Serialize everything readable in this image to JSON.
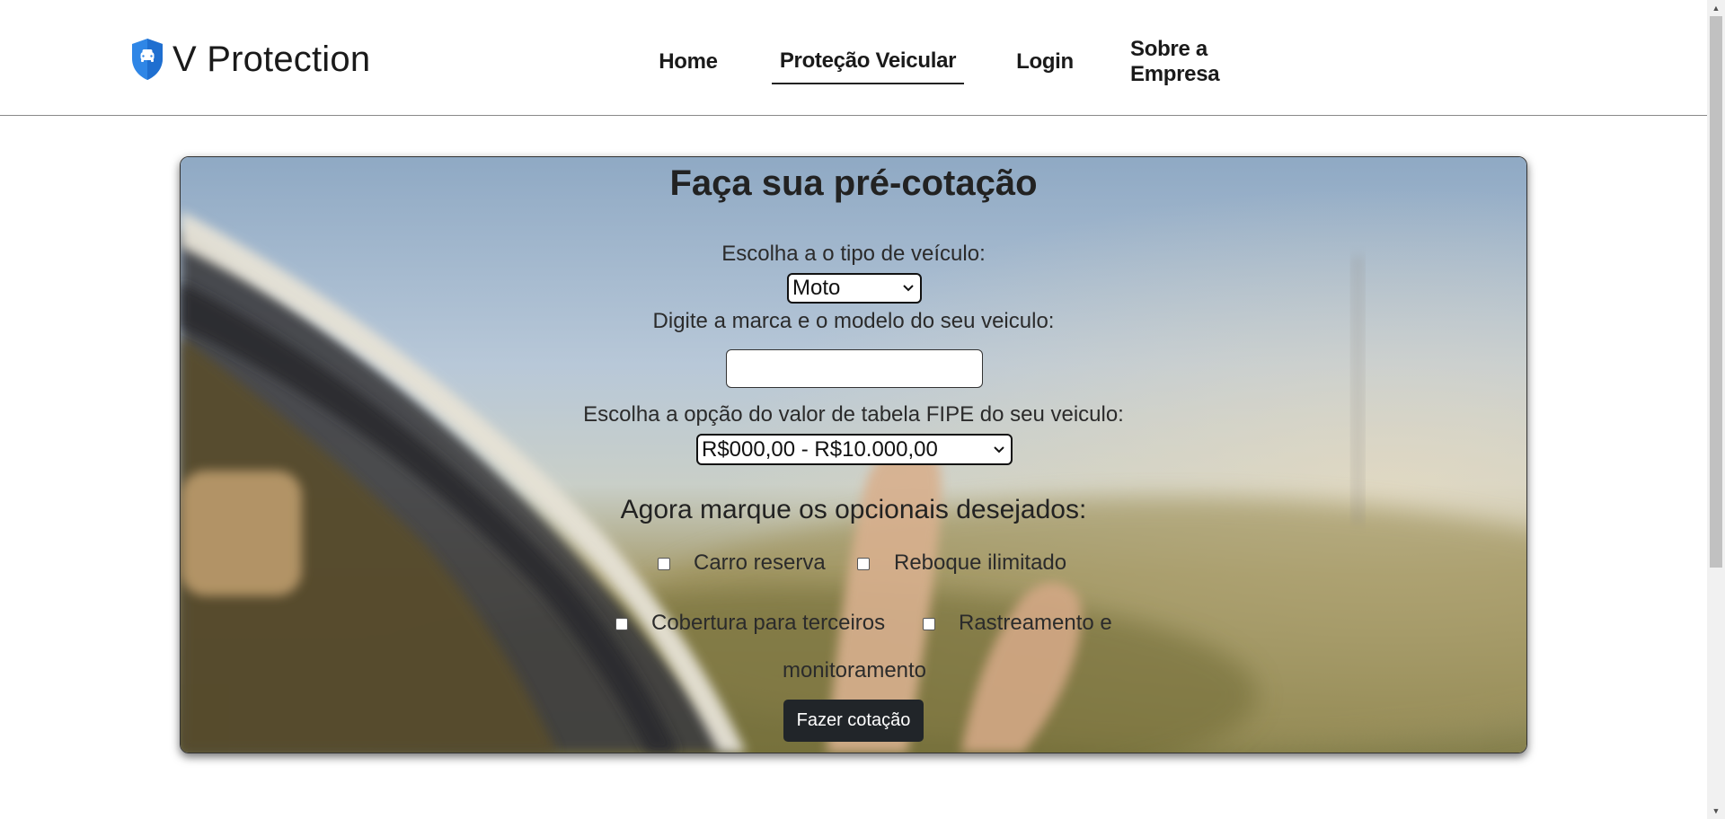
{
  "brand": {
    "name": "V Protection",
    "icon": "shield-car-icon",
    "color": "#2f86e6"
  },
  "nav": {
    "items": [
      {
        "label": "Home",
        "active": false
      },
      {
        "label": "Proteção Veicular",
        "active": true
      },
      {
        "label": "Login",
        "active": false
      },
      {
        "label": "Sobre a Empresa",
        "active": false
      }
    ]
  },
  "form": {
    "title": "Faça sua pré-cotação",
    "vehicle_type_label": "Escolha a o tipo de veículo:",
    "vehicle_type_value": "Moto",
    "model_label": "Digite a marca e o modelo do seu veiculo:",
    "model_value": "",
    "fipe_label": "Escolha a opção do valor de tabela FIPE do seu veiculo:",
    "fipe_value": "R$000,00 - R$10.000,00",
    "optionals_title": "Agora marque os opcionais desejados:",
    "optionals": [
      {
        "label": "Carro reserva",
        "checked": false
      },
      {
        "label": "Reboque ilimitado",
        "checked": false
      },
      {
        "label": "Cobertura para terceiros",
        "checked": false
      },
      {
        "label": "Rastreamento e",
        "checked": false
      },
      {
        "label": "monitoramento"
      }
    ],
    "submit_label": "Fazer cotação"
  },
  "colors": {
    "nav_text": "#1a1a1a",
    "button_bg": "#212529",
    "button_text": "#ffffff"
  }
}
